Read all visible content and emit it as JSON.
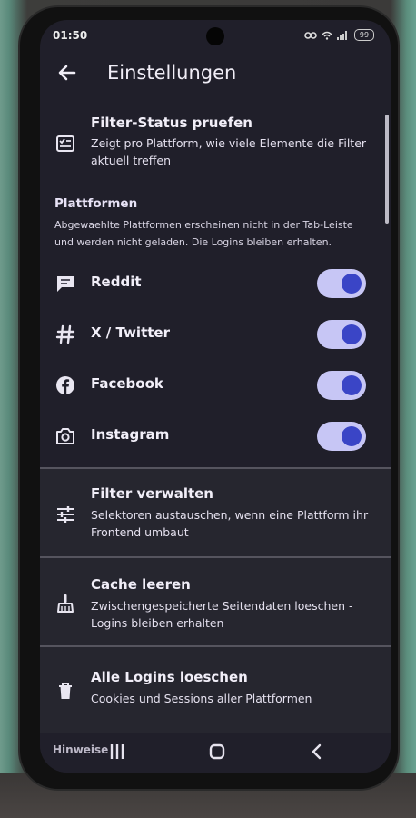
{
  "status_bar": {
    "time": "01:50",
    "battery": "99"
  },
  "app_bar": {
    "title": "Einstellungen"
  },
  "filter_status": {
    "title": "Filter-Status pruefen",
    "subtitle": "Zeigt pro Plattform, wie viele Elemente die Filter aktuell treffen",
    "icon": "list-check-icon"
  },
  "platforms": {
    "header": "Plattformen",
    "description": "Abgewaehlte Plattformen erscheinen nicht in der Tab-Leiste und werden nicht geladen. Die Logins bleiben erhalten.",
    "items": [
      {
        "label": "Reddit",
        "icon": "chat-bubble-icon",
        "enabled": true
      },
      {
        "label": "X / Twitter",
        "icon": "hashtag-icon",
        "enabled": true
      },
      {
        "label": "Facebook",
        "icon": "facebook-icon",
        "enabled": true
      },
      {
        "label": "Instagram",
        "icon": "camera-icon",
        "enabled": true
      }
    ]
  },
  "filter_manage": {
    "title": "Filter verwalten",
    "subtitle": "Selektoren austauschen, wenn eine Plattform ihr Frontend umbaut",
    "icon": "sliders-icon"
  },
  "cache_clear": {
    "title": "Cache leeren",
    "subtitle": "Zwischengespeicherte Seitendaten loeschen - Logins bleiben erhalten",
    "icon": "broom-icon"
  },
  "logins_delete": {
    "title": "Alle Logins loeschen",
    "subtitle": "Cookies und Sessions aller Plattformen",
    "icon": "trash-icon"
  },
  "bottom": {
    "hint_label": "Hinweise"
  },
  "colors": {
    "background": "#201f2a",
    "toggle_track": "#c7c6f5",
    "toggle_knob": "#3a45c6",
    "card": "#26262f"
  }
}
